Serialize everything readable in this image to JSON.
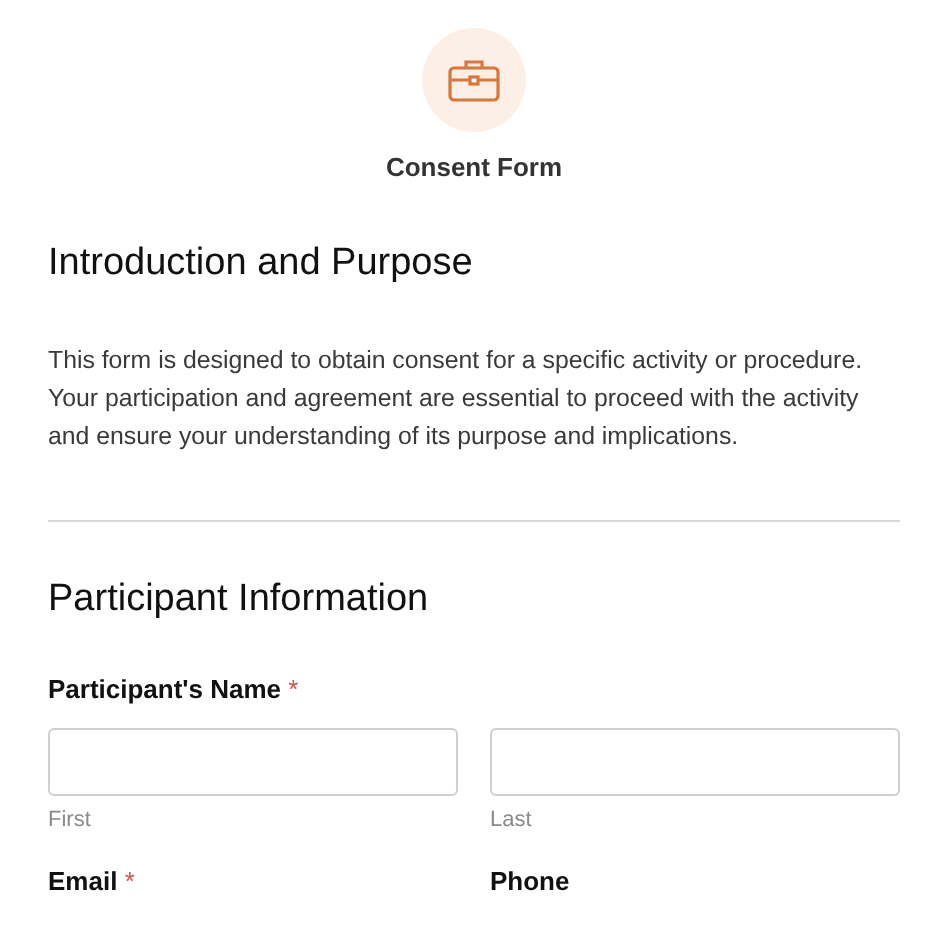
{
  "header": {
    "title": "Consent Form"
  },
  "sections": [
    {
      "heading": "Introduction and Purpose",
      "paragraph": "This form is designed to obtain consent for a specific activity or procedure. Your participation and agreement are essential to proceed with the activity and ensure your understanding of its purpose and implications."
    },
    {
      "heading": "Participant Information",
      "fields": [
        {
          "label": "Participant's Name",
          "required_mark": "*",
          "inputs": [
            {
              "sublabel": "First"
            },
            {
              "sublabel": "Last"
            }
          ]
        }
      ],
      "cut_labels": [
        {
          "label": "Email",
          "required_mark": "*"
        },
        {
          "label": "Phone"
        }
      ]
    }
  ]
}
